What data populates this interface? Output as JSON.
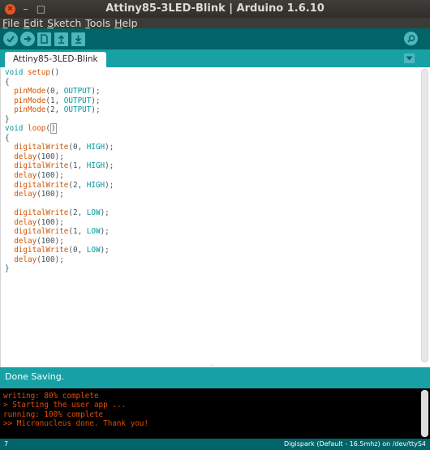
{
  "window": {
    "title": "Attiny85-3LED-Blink | Arduino 1.6.10",
    "close_glyph": "×",
    "minimize_glyph": "–",
    "maximize_glyph": "□"
  },
  "menu": [
    {
      "label": "File",
      "mnemonic": "F"
    },
    {
      "label": "Edit",
      "mnemonic": "E"
    },
    {
      "label": "Sketch",
      "mnemonic": "S"
    },
    {
      "label": "Tools",
      "mnemonic": "T"
    },
    {
      "label": "Help",
      "mnemonic": "H"
    }
  ],
  "toolbar": {
    "buttons": [
      {
        "name": "verify-icon"
      },
      {
        "name": "upload-icon"
      },
      {
        "name": "new-icon"
      },
      {
        "name": "open-icon"
      },
      {
        "name": "save-icon"
      }
    ],
    "serial_monitor_icon": "magnifier-icon"
  },
  "tabs": [
    {
      "label": "Attiny85-3LED-Blink",
      "active": true
    }
  ],
  "editor": {
    "lines": [
      "void setup()",
      "{",
      "  pinMode(0, OUTPUT);",
      "  pinMode(1, OUTPUT);",
      "  pinMode(2, OUTPUT);",
      "}",
      "void loop()",
      "{",
      "  digitalWrite(0, HIGH);",
      "  delay(100);",
      "  digitalWrite(1, HIGH);",
      "  delay(100);",
      "  digitalWrite(2, HIGH);",
      "  delay(100);",
      "",
      "  digitalWrite(2, LOW);",
      "  delay(100);",
      "  digitalWrite(1, LOW);",
      "  delay(100);",
      "  digitalWrite(0, LOW);",
      "  delay(100);",
      "}"
    ]
  },
  "status": {
    "message": "Done Saving."
  },
  "console": {
    "lines": [
      "writing: 80% complete",
      "> Starting the user app ...",
      "running: 100% complete",
      ">> Micronucleus done. Thank you!"
    ]
  },
  "footer": {
    "line_number": "7",
    "board": "Digispark (Default - 16.5mhz) on /dev/ttyS4"
  },
  "colors": {
    "teal_dark": "#006468",
    "teal": "#17a1a5",
    "button": "#4db7bb",
    "keyword": "#00979c",
    "function": "#d35400",
    "console_text": "#e34c00"
  }
}
